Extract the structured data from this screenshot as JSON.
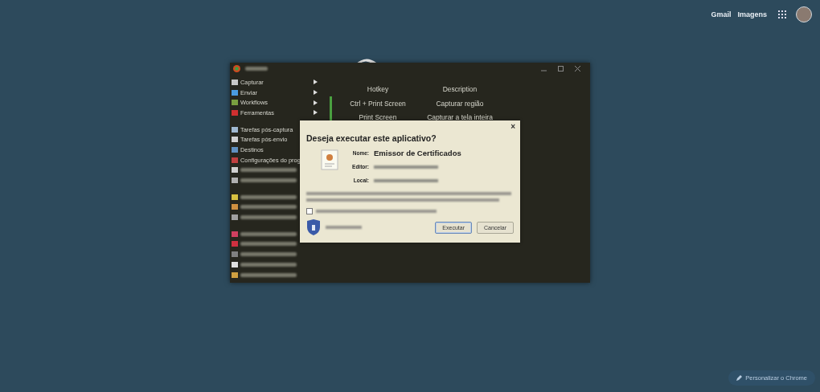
{
  "top_bar": {
    "links": [
      "Gmail",
      "Imagens"
    ]
  },
  "app_window": {
    "menu_groups": [
      [
        {
          "kind": "item",
          "label": "Capturar",
          "submenu": true
        },
        {
          "kind": "item",
          "label": "Enviar",
          "submenu": true
        },
        {
          "kind": "item",
          "label": "Workflows",
          "submenu": true
        },
        {
          "kind": "item",
          "label": "Ferramentas",
          "submenu": true
        }
      ],
      [
        {
          "kind": "item",
          "label": "Tarefas pós-captura"
        },
        {
          "kind": "item",
          "label": "Tarefas pós-envio"
        },
        {
          "kind": "item",
          "label": "Destinos"
        },
        {
          "kind": "item",
          "label": "Configurações do prog"
        },
        {
          "kind": "blurred"
        },
        {
          "kind": "blurred"
        }
      ],
      [
        {
          "kind": "blurred"
        },
        {
          "kind": "blurred"
        },
        {
          "kind": "blurred"
        }
      ],
      [
        {
          "kind": "blurred"
        },
        {
          "kind": "blurred"
        },
        {
          "kind": "blurred"
        },
        {
          "kind": "blurred"
        },
        {
          "kind": "blurred"
        }
      ]
    ],
    "hotkeys": {
      "columns": [
        "Hotkey",
        "Description"
      ],
      "rows": [
        [
          "Ctrl + Print Screen",
          "Capturar região"
        ],
        [
          "Print Screen",
          "Capturar a tela inteira"
        ]
      ]
    }
  },
  "dialog": {
    "title": "Deseja executar este aplicativo?",
    "close": "×",
    "fields": [
      {
        "label": "Nome:",
        "value": "Emissor de Certificados"
      },
      {
        "label": "Editor:"
      },
      {
        "label": "Local:"
      }
    ],
    "checkbox": {
      "checked": false
    },
    "buttons": [
      {
        "label": "Executar",
        "selected": true
      },
      {
        "label": "Cancelar",
        "selected": false
      }
    ]
  },
  "customize_button": "Personalizar o Chrome"
}
